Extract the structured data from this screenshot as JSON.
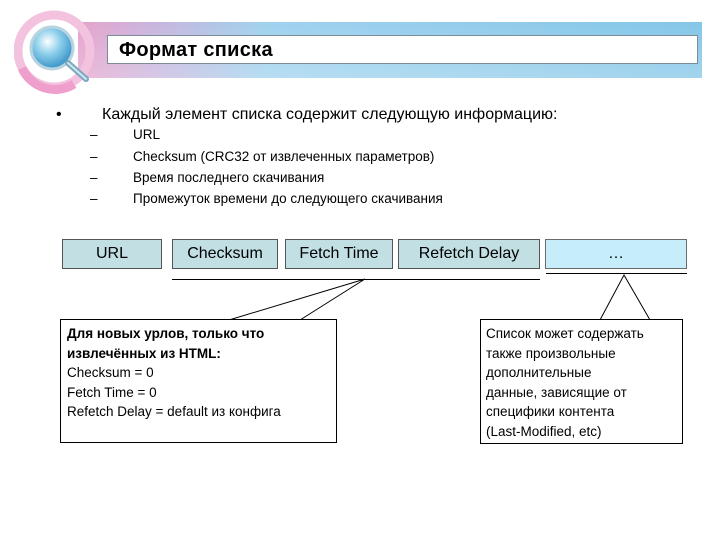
{
  "slide": {
    "title": "Формат списка",
    "bullet": {
      "marker": "•",
      "text": "Каждый элемент списка содержит следующую информацию:",
      "sub_marker": "–",
      "subitems": [
        "URL",
        "Checksum (CRC32 от извлеченных параметров)",
        "Время последнего скачивания",
        "Промежуток времени до следующего скачивания"
      ]
    },
    "fields": [
      {
        "label": "URL"
      },
      {
        "label": "Checksum"
      },
      {
        "label": "Fetch Time"
      },
      {
        "label": "Refetch Delay"
      },
      {
        "label": "…"
      }
    ],
    "notes": {
      "new_urls": {
        "heading_line1": "Для новых урлов, только что",
        "heading_line2": "извлечённых из HTML:",
        "lines": [
          "Checksum = 0",
          "Fetch Time = 0",
          "Refetch Delay = default из конфига"
        ]
      },
      "extra_data": {
        "lines": [
          "Список может содержать",
          "также произвольные",
          "дополнительные",
          "данные, зависящие от",
          "специфики контента",
          "(Last-Modified, etc)"
        ]
      }
    },
    "colors": {
      "field_fill": "#c2e0e4",
      "extra_field_fill": "#c6eefa",
      "banner_blue": "#86c8ea",
      "banner_pink": "#e6a3cc"
    }
  }
}
